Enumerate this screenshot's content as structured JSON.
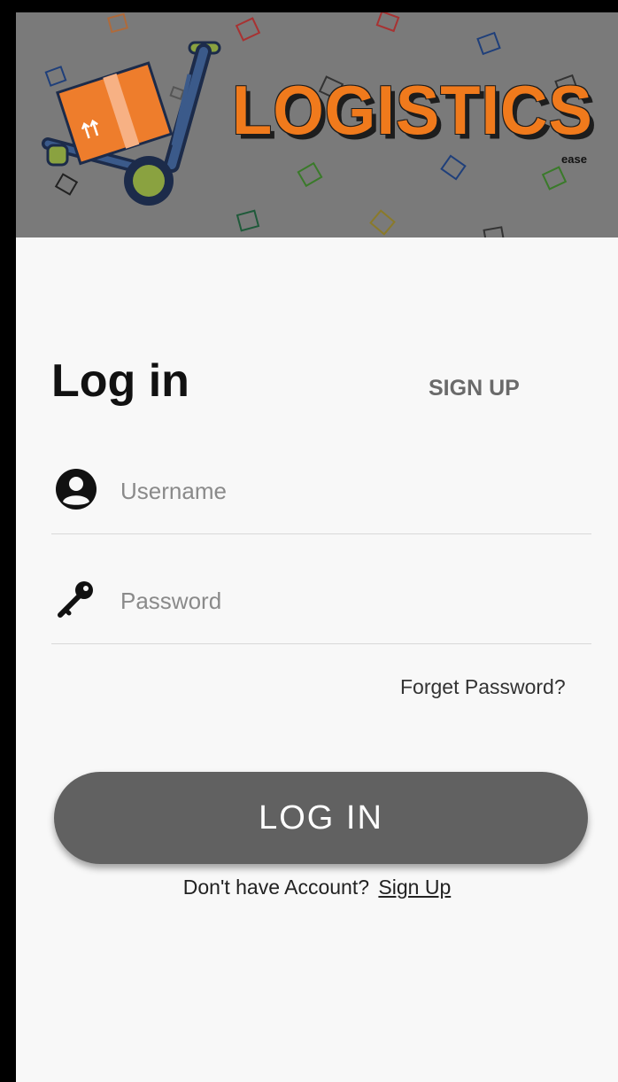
{
  "brand": {
    "name": "LOGISTICS",
    "subtitle": "ease",
    "header_bg": "#7a7a7a",
    "accent": "#f07a1c"
  },
  "login": {
    "title": "Log in",
    "signup_tab": "SIGN UP",
    "username_placeholder": "Username",
    "username_icon": "user-circle-icon",
    "password_placeholder": "Password",
    "password_icon": "key-icon",
    "forgot_password": "Forget Password?",
    "submit_label": "LOG IN",
    "submit_color": "#616161",
    "no_account_text": "Don't have Account?",
    "signup_link": "Sign Up"
  }
}
